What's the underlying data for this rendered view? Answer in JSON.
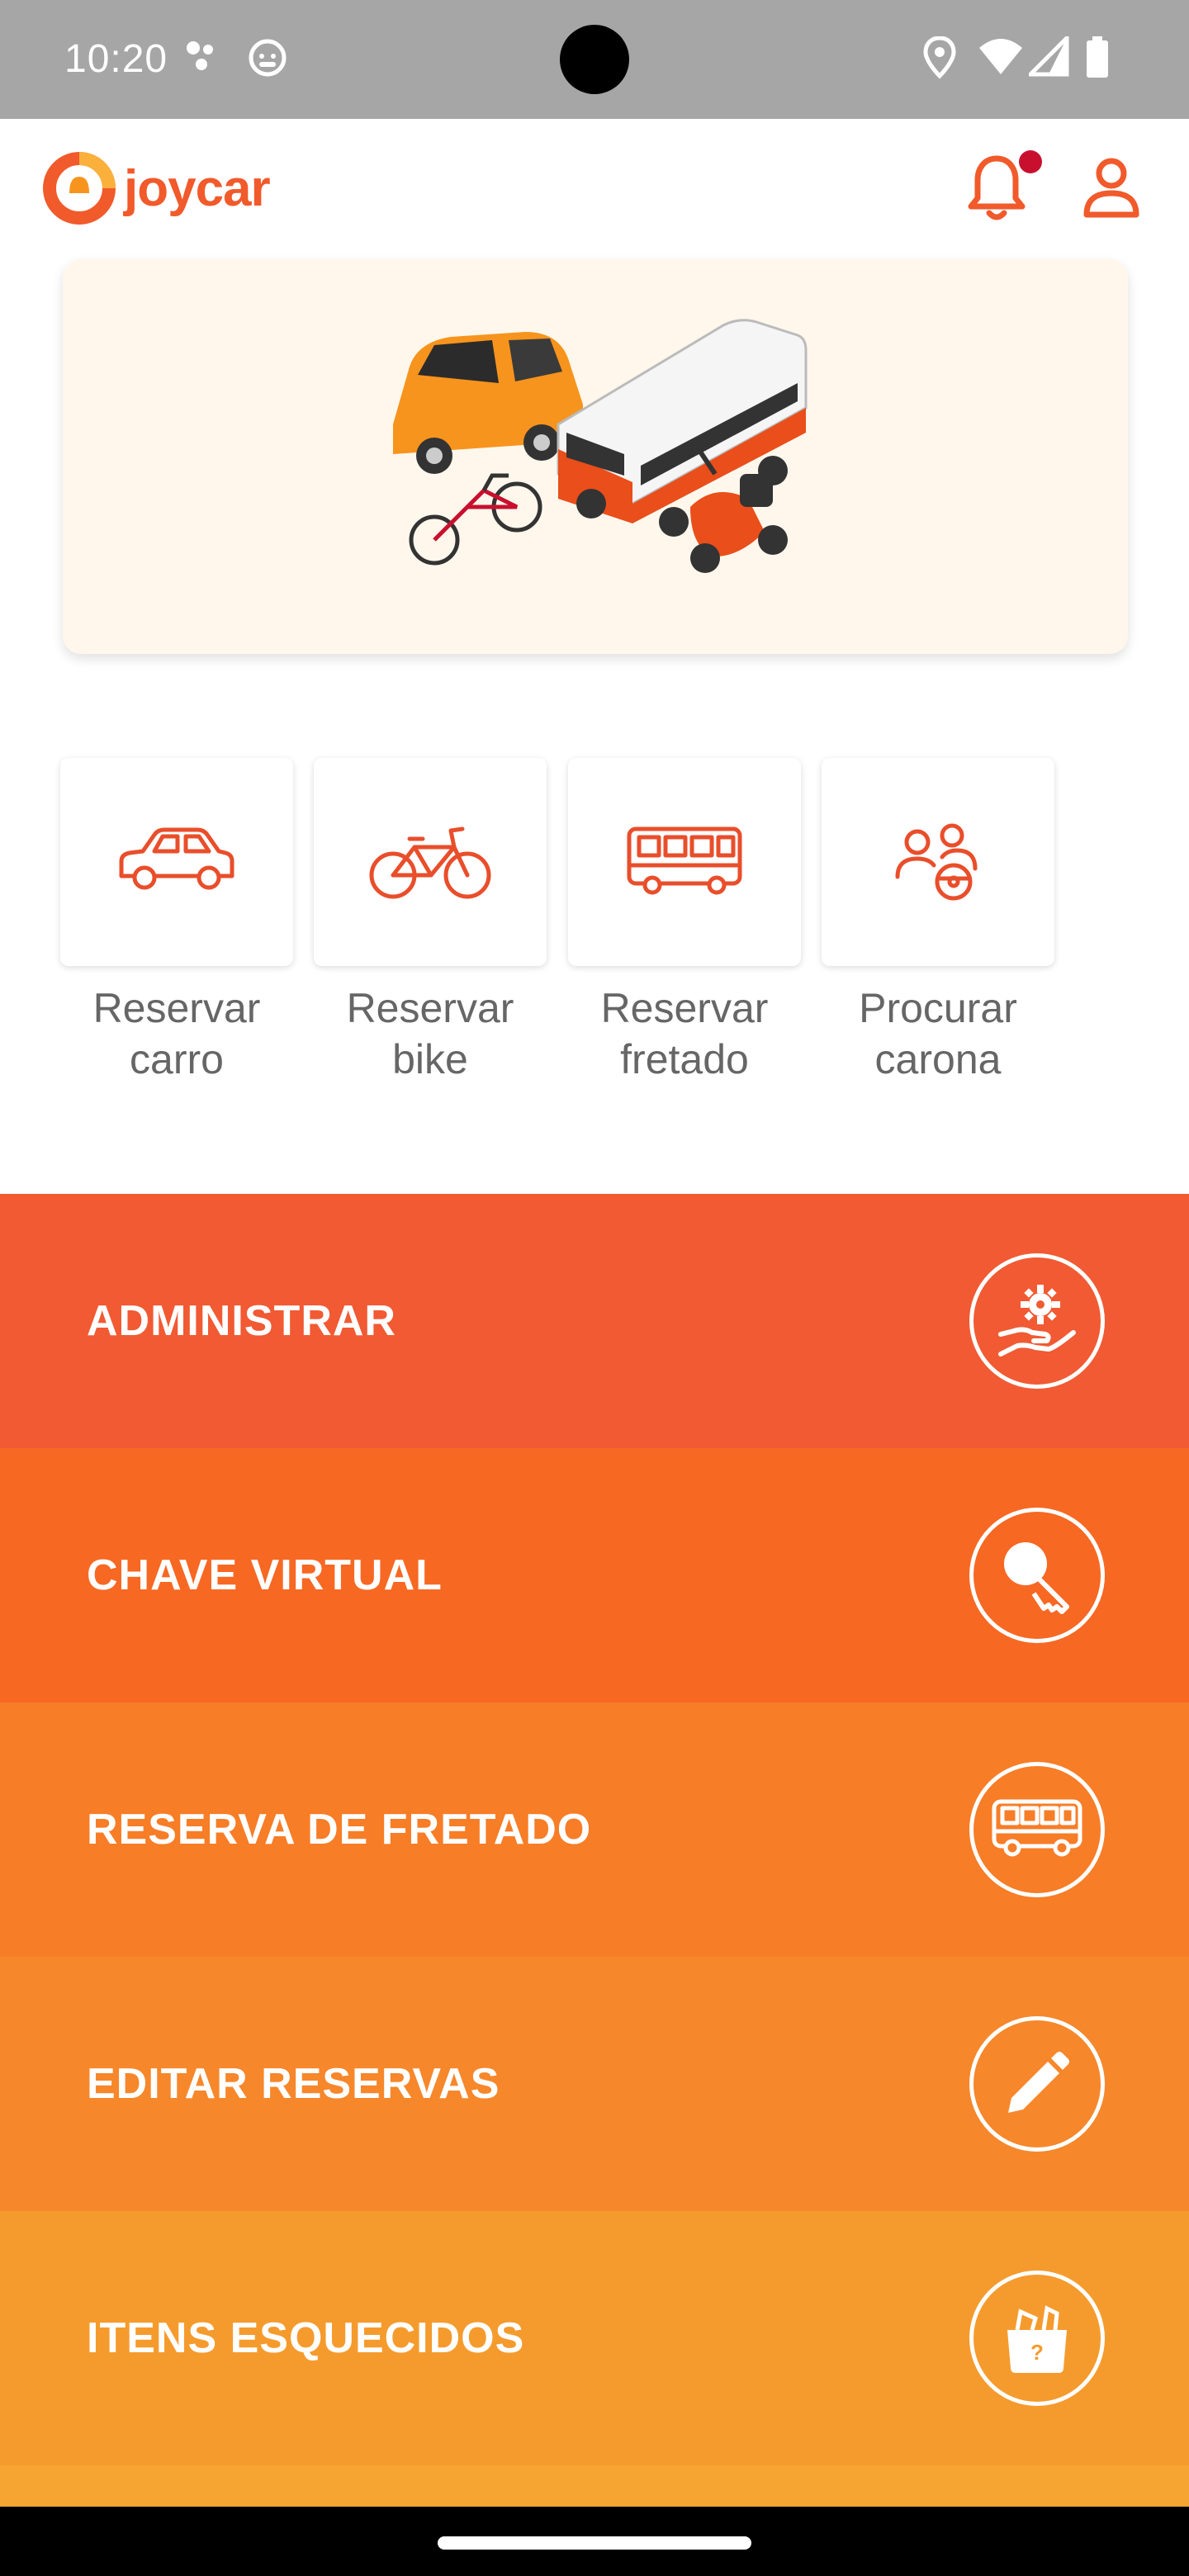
{
  "status_bar": {
    "time": "10:20"
  },
  "header": {
    "logo_text": "joycar"
  },
  "quick_actions": [
    {
      "label": "Reservar\ncarro",
      "icon": "car-icon"
    },
    {
      "label": "Reservar\nbike",
      "icon": "bike-icon"
    },
    {
      "label": "Reservar\nfretado",
      "icon": "bus-icon"
    },
    {
      "label": "Procurar\ncarona",
      "icon": "carpool-icon"
    }
  ],
  "menu": [
    {
      "label": "ADMINISTRAR",
      "icon": "hand-gear-icon",
      "color": "#f15a33"
    },
    {
      "label": "CHAVE VIRTUAL",
      "icon": "key-icon",
      "color": "#f76823"
    },
    {
      "label": "RESERVA DE FRETADO",
      "icon": "bus-icon",
      "color": "#f77d27"
    },
    {
      "label": "EDITAR RESERVAS",
      "icon": "pencil-icon",
      "color": "#f6872b"
    },
    {
      "label": "ITENS ESQUECIDOS",
      "icon": "lost-items-box-icon",
      "color": "#f59b2d"
    }
  ],
  "colors": {
    "brand": "#f15a2b",
    "notification_dot": "#c8102e",
    "banner_bg": "#fff7ec"
  }
}
